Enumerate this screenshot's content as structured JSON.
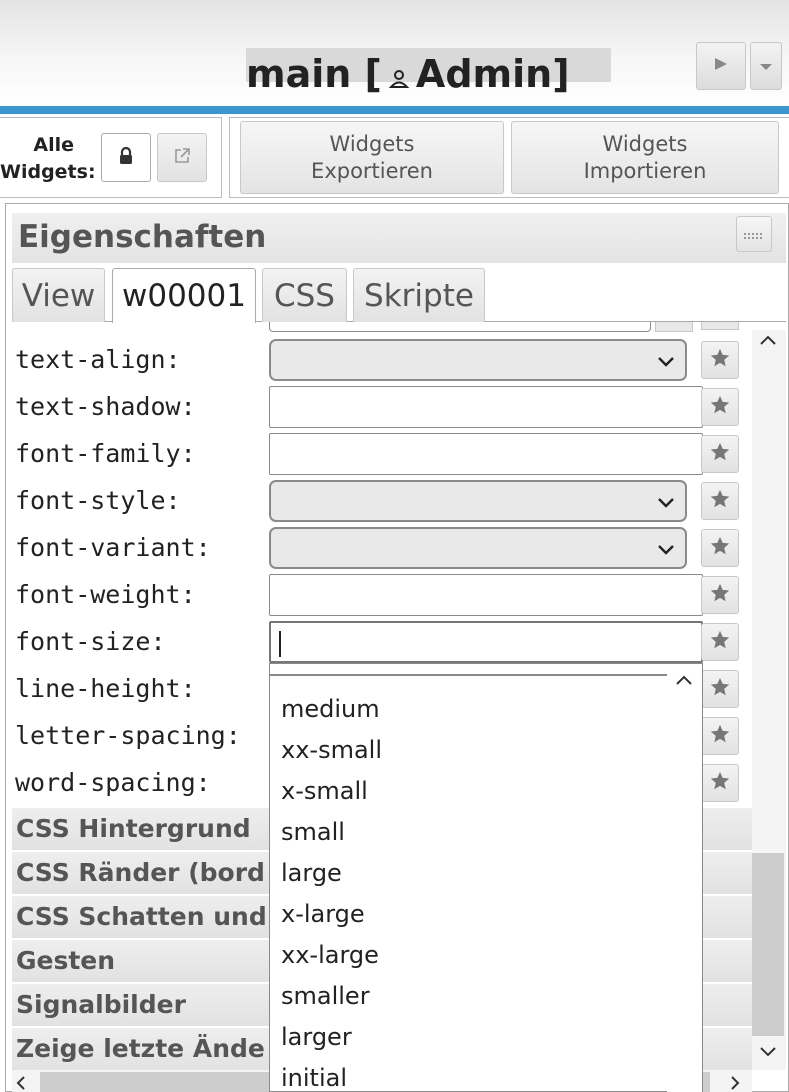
{
  "app": {
    "title_prefix": "main [",
    "title_user": "Admin]"
  },
  "toolbar": {
    "all_widgets_label_line1": "Alle",
    "all_widgets_label_line2": "Widgets:",
    "export_line1": "Widgets",
    "export_line2": "Exportieren",
    "import_line1": "Widgets",
    "import_line2": "Importieren"
  },
  "panel": {
    "title": "Eigenschaften",
    "tabs": [
      {
        "label": "View",
        "active": false
      },
      {
        "label": "w00001",
        "active": true
      },
      {
        "label": "CSS",
        "active": false
      },
      {
        "label": "Skripte",
        "active": false
      }
    ],
    "properties": [
      {
        "label": "text-align:",
        "type": "select"
      },
      {
        "label": "text-shadow:",
        "type": "input"
      },
      {
        "label": "font-family:",
        "type": "input"
      },
      {
        "label": "font-style:",
        "type": "select"
      },
      {
        "label": "font-variant:",
        "type": "select"
      },
      {
        "label": "font-weight:",
        "type": "input"
      },
      {
        "label": "font-size:",
        "type": "input",
        "focused": true
      },
      {
        "label": "line-height:",
        "type": "input"
      },
      {
        "label": "letter-spacing:",
        "type": "input"
      },
      {
        "label": "word-spacing:",
        "type": "input"
      }
    ],
    "groups": [
      "CSS Hintergrund",
      "CSS Ränder (bord",
      "CSS Schatten und",
      "Gesten",
      "Signalbilder",
      "Zeige letzte Ände"
    ]
  },
  "dropdown": {
    "options": [
      "medium",
      "xx-small",
      "x-small",
      "small",
      "large",
      "x-large",
      "xx-large",
      "smaller",
      "larger",
      "initial"
    ]
  },
  "colors": {
    "accent_bar": "#3c97cf",
    "group_text": "#555555"
  },
  "icons": [
    "play-icon",
    "menu-caret-icon",
    "person-icon",
    "lock-icon",
    "open-external-icon",
    "panel-menu-icon",
    "chevron-down-icon",
    "star-icon",
    "chevron-up-icon",
    "scroll-left-icon",
    "scroll-right-icon"
  ]
}
